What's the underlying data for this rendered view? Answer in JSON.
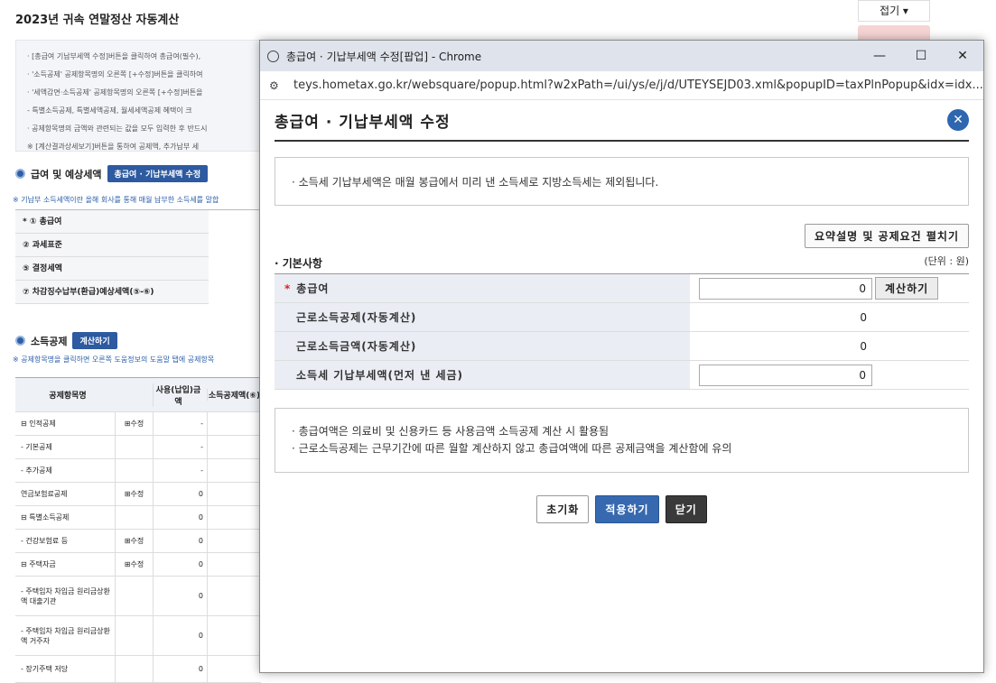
{
  "background": {
    "page_title": "2023년 귀속 연말정산 자동계산",
    "fold_label": "접기 ▾",
    "notice_lines": [
      "· [총급여 기납부세액 수정]버튼을 클릭하여 총급여(필수),",
      "· '소득공제' 공제항목명의 오른쪽 [+수정]버튼을 클릭하여",
      "· '세액감면·소득공제' 공제항목명의 오른쪽 [+수정]버튼을",
      "  - 특별소득공제, 특별세액공제, 월세세액공제 혜택이 크",
      "· 공제항목명의 금액와 관련되는 값을 모두 입력한 후 반드시",
      "  ※ [계산결과상세보기]버튼을 통하여 공제액, 추가납부 세"
    ],
    "section1": {
      "title": "급여 및 예상세액",
      "button": "총급여 · 기납부세액 수정"
    },
    "section1_hint": "※ 기납부 소득세액이란 올해 회사를 통해 매월 납부한 소득세를 말합",
    "summary_rows": [
      "* ① 총급여",
      "② 과세표준",
      "⑤ 결정세액",
      "⑦ 차감징수납부(환급)예상세액(⑤-⑥)"
    ],
    "section2": {
      "title": "소득공제",
      "button": "계산하기"
    },
    "section2_hint": "※ 공제항목명을 클릭하면 오른쪽 도움정보의 도움말 탭에 공제항목",
    "grid_headers": [
      "공제항목명",
      "",
      "사용(납입)금액",
      "소득공제액(⑥)"
    ],
    "grid_rows": [
      {
        "name": "⊟ 인적공제",
        "edit": "⊞수정",
        "amount": "-"
      },
      {
        "name": "  - 기본공제",
        "edit": "",
        "amount": "-"
      },
      {
        "name": "  - 추가공제",
        "edit": "",
        "amount": "-"
      },
      {
        "name": "연금보험료공제",
        "edit": "⊞수정",
        "amount": "0"
      },
      {
        "name": "⊟ 특별소득공제",
        "edit": "",
        "amount": "0"
      },
      {
        "name": "  - 건강보험료 등",
        "edit": "⊞수정",
        "amount": "0"
      },
      {
        "name": "  ⊟ 주택자금",
        "edit": "⊞수정",
        "amount": "0"
      },
      {
        "name": "    - 주택임차 차입금 원리금상환액 대출기관",
        "edit": "",
        "amount": "0"
      },
      {
        "name": "    - 주택임차 차입금 원리금상환액 거주자",
        "edit": "",
        "amount": "0"
      },
      {
        "name": "    - 장기주택 저당",
        "edit": "",
        "amount": "0"
      }
    ]
  },
  "popup": {
    "window_title": "총급여 · 기납부세액 수정[팝업] - Chrome",
    "controls": {
      "minimize": "—",
      "maximize": "☐",
      "close": "✕"
    },
    "url": "teys.hometax.go.kr/websquare/popup.html?w2xPath=/ui/ys/e/j/d/UTEYSEJD03.xml&popupID=taxPlnPopup&idx=idx...",
    "heading": "총급여 · 기납부세액 수정",
    "close_symbol": "✕",
    "info_top": "· 소득세 기납부세액은 매월 봉급에서 미리 낸 소득세로 지방소득세는 제외됩니다.",
    "summary_button": "요약설명 및 공제요건 펼치기",
    "section_label": "· 기본사항",
    "unit_label": "(단위 : 원)",
    "rows": {
      "gross": {
        "label": "총급여",
        "value": "0",
        "button": "계산하기"
      },
      "earned_deduction": {
        "label": "근로소득공제(자동계산)",
        "value": "0"
      },
      "earned_income": {
        "label": "근로소득금액(자동계산)",
        "value": "0"
      },
      "prepaid_tax": {
        "label": "소득세 기납부세액(먼저 낸 세금)",
        "value": "0"
      }
    },
    "info_bottom": [
      "· 총급여액은 의료비 및 신용카드 등 사용금액 소득공제 계산 시 활용됨",
      "· 근로소득공제는 근무기간에 따른 월할 계산하지 않고 총급여액에 따른 공제금액을 계산함에 유의"
    ],
    "buttons": {
      "reset": "초기화",
      "apply": "적용하기",
      "close": "닫기"
    }
  }
}
